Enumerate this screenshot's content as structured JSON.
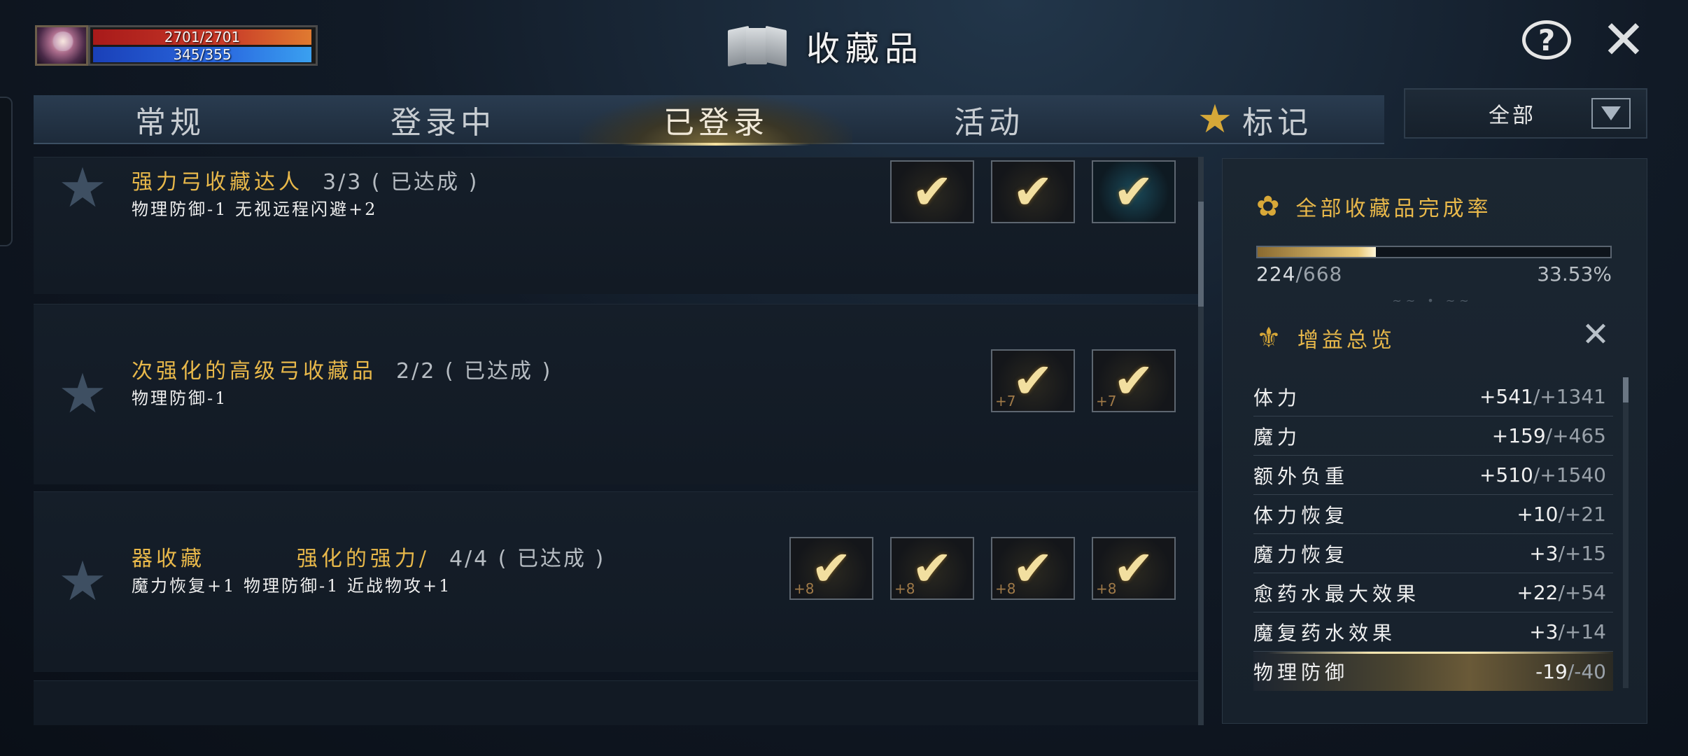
{
  "player": {
    "hp_text": "2701/2701",
    "mp_text": "345/355"
  },
  "header": {
    "title": "收藏品",
    "help_glyph": "?",
    "close_glyph": "✕"
  },
  "tabs": [
    {
      "label": "常规"
    },
    {
      "label": "登录中"
    },
    {
      "label": "已登录"
    },
    {
      "label": "活动"
    },
    {
      "label": "标记",
      "icon": "star-icon"
    }
  ],
  "active_tab": 2,
  "filter": {
    "selected": "全部"
  },
  "collections": [
    {
      "name": "强力弓收藏达人",
      "progress": "3/3 ( 已达成 )",
      "bonus": "物理防御-1   无视远程闪避+2",
      "slots": [
        {
          "plus": ""
        },
        {
          "plus": ""
        },
        {
          "plus": "",
          "variant": "blue"
        }
      ]
    },
    {
      "name": "次强化的高级弓收藏品",
      "progress": "2/2 ( 已达成 )",
      "bonus": "物理防御-1",
      "slots": [
        {
          "plus": "+7"
        },
        {
          "plus": "+7"
        }
      ]
    },
    {
      "name": "器收藏         强化的强力/",
      "progress": "4/4 ( 已达成 )",
      "bonus": "魔力恢复+1   物理防御-1   近战物攻+1",
      "slots": [
        {
          "plus": "+8"
        },
        {
          "plus": "+8"
        },
        {
          "plus": "+8"
        },
        {
          "plus": "+8"
        }
      ]
    }
  ],
  "completion": {
    "title": "全部收藏品完成率",
    "count": "224",
    "total": "/668",
    "percent_text": "33.53%",
    "fraction": 0.3353
  },
  "buff": {
    "title": "增益总览",
    "close_glyph": "✕",
    "stats": [
      {
        "name": "体力",
        "value": "+541",
        "max": "/+1341"
      },
      {
        "name": "魔力",
        "value": "+159",
        "max": "/+465"
      },
      {
        "name": "额外负重",
        "value": "+510",
        "max": "/+1540"
      },
      {
        "name": "体力恢复",
        "value": "+10",
        "max": "/+21"
      },
      {
        "name": "魔力恢复",
        "value": "+3",
        "max": "/+15"
      },
      {
        "name": "愈药水最大效果",
        "value": "+22",
        "max": "/+54"
      },
      {
        "name": "魔复药水效果",
        "value": "+3",
        "max": "/+14"
      },
      {
        "name": "物理防御",
        "value": "-19",
        "max": "/-40",
        "highlight": true
      }
    ]
  },
  "colors": {
    "gold_text": "#e8b84a",
    "hp_bar": "#c83a28",
    "mp_bar": "#2a6ae0",
    "star_inactive": "#3e4f62",
    "star_active": "#d6a838"
  }
}
